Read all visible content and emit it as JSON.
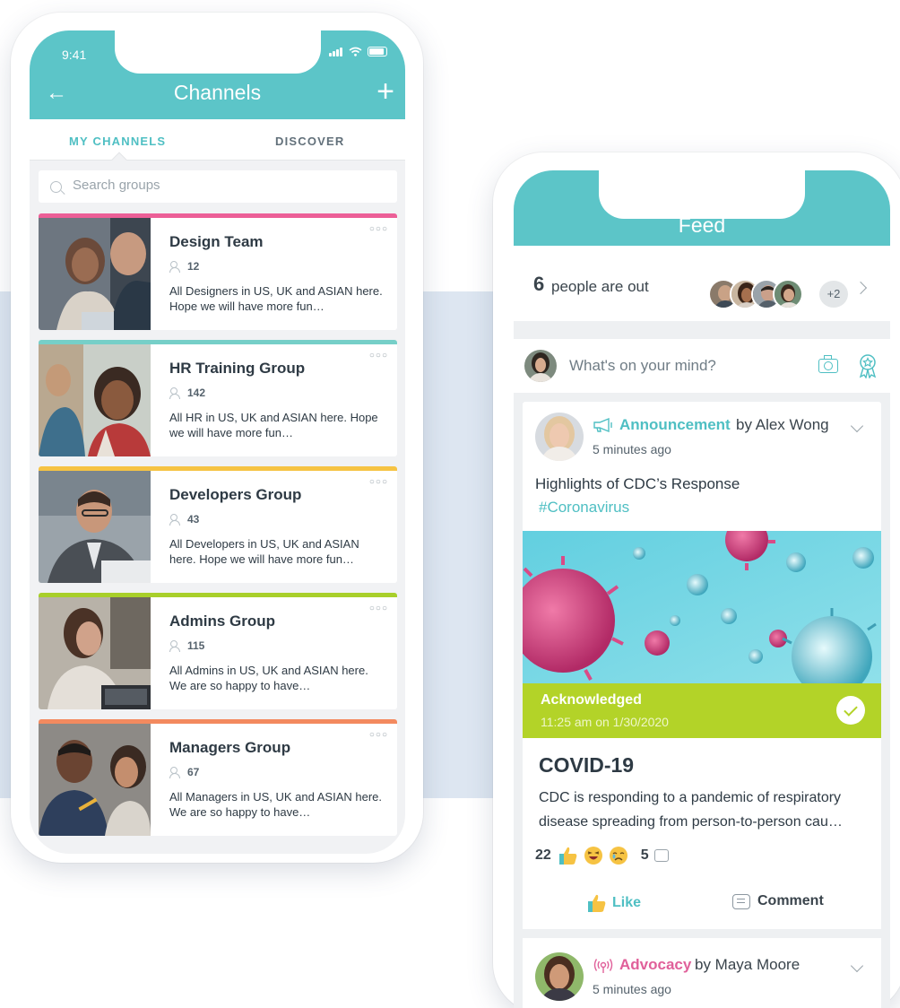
{
  "channels_screen": {
    "status_time": "9:41",
    "title": "Channels",
    "tabs": [
      {
        "label": "MY CHANNELS",
        "active": true
      },
      {
        "label": "DISCOVER",
        "active": false
      }
    ],
    "search_placeholder": "Search groups",
    "groups": [
      {
        "name": "Design Team",
        "members": "12",
        "desc": "All Designers in US, UK and ASIAN here. Hope we will have more fun…",
        "accent": "#ec5f97"
      },
      {
        "name": "HR Training Group",
        "members": "142",
        "desc": "All HR in US, UK and ASIAN here. Hope we will have more fun…",
        "accent": "#76cfc8"
      },
      {
        "name": "Developers Group",
        "members": "43",
        "desc": "All Developers in US, UK and ASIAN here. Hope we will have more fun…",
        "accent": "#f6c343"
      },
      {
        "name": "Admins Group",
        "members": "115",
        "desc": "All Admins in US, UK and ASIAN here. We are so happy to have…",
        "accent": "#a8cf2a"
      },
      {
        "name": "Managers Group",
        "members": "67",
        "desc": "All Managers in US, UK and ASIAN here. We are so happy to have…",
        "accent": "#f38a5f"
      }
    ]
  },
  "feed_screen": {
    "title": "Feed",
    "out": {
      "count": "6",
      "text": "people are out",
      "more": "+2"
    },
    "compose_placeholder": "What's on your mind?",
    "post": {
      "type": "Announcement",
      "by": "by Alex Wong",
      "time": "5 minutes ago",
      "headline": "Highlights of CDC’s Response",
      "hashtag": "#Coronavirus",
      "ack_title": "Acknowledged",
      "ack_time": "11:25 am on 1/30/2020",
      "title": "COVID-19",
      "body": "CDC is responding to a pandemic of respiratory disease spreading from person-to-person cau…",
      "reactions_count": "22",
      "comments_count": "5",
      "like_label": "Like",
      "comment_label": "Comment"
    },
    "post2": {
      "type": "Advocacy",
      "by": "by Maya Moore",
      "time": "5 minutes ago"
    }
  },
  "colors": {
    "teal": "#5cc5c8",
    "teal_text": "#4fbfc3",
    "lime": "#b3d328",
    "pink": "#e0609a"
  }
}
